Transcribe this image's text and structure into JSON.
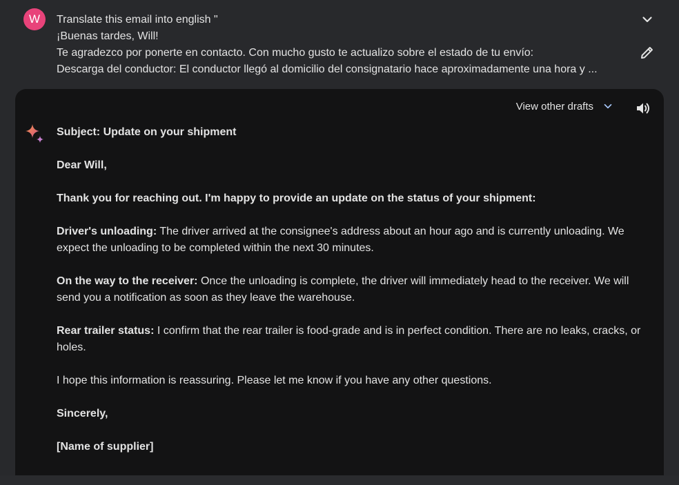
{
  "prompt": {
    "avatar_letter": "W",
    "lines": [
      "Translate this email into english \"",
      "¡Buenas tardes, Will!",
      "Te agradezco por ponerte en contacto. Con mucho gusto te actualizo sobre el estado de tu envío:",
      "Descarga del conductor: El conductor llegó al domicilio del consignatario hace aproximadamente una hora y ..."
    ],
    "expand_icon": "chevron-down-icon",
    "edit_icon": "pencil-icon"
  },
  "response": {
    "drafts_label": "View other drafts",
    "speaker_icon": "volume-icon",
    "sparkle_icon": "gemini-sparkle-icon",
    "subject": "Subject: Update on your shipment",
    "greeting": "Dear Will,",
    "intro": "Thank you for reaching out. I'm happy to provide an update on the status of your shipment:",
    "unloading_label": "Driver's unloading:",
    "unloading_text": " The driver arrived at the consignee's address about an hour ago and is currently unloading. We expect the unloading to be completed within the next 30 minutes.",
    "receiver_label": "On the way to the receiver:",
    "receiver_text": " Once the unloading is complete, the driver will immediately head to the receiver. We will send you a notification as soon as they leave the warehouse.",
    "trailer_label": "Rear trailer status:",
    "trailer_text": " I confirm that the rear trailer is food-grade and is in perfect condition. There are no leaks, cracks, or holes.",
    "closing_note": "I hope this information is reassuring. Please let me know if you have any other questions.",
    "signoff": "Sincerely,",
    "signature": "[Name of supplier]"
  },
  "colors": {
    "page_bg": "#28292c",
    "card_bg": "#131314",
    "text": "#e3e3e3",
    "avatar": "#e8437a",
    "sparkle_blue": "#6fa0f6",
    "sparkle_orange": "#f29a54"
  }
}
